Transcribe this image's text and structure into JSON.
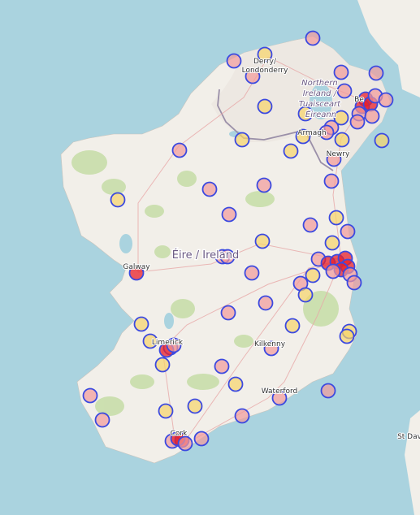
{
  "map": {
    "country_label": "Éire / Ireland",
    "region_label_lines": [
      "Northern",
      "Ireland /",
      "Tuaisceart",
      "Éireann"
    ],
    "places": [
      {
        "id": "derry",
        "lines": [
          "Derry/",
          "Londonderry"
        ]
      },
      {
        "id": "armagh",
        "lines": [
          "Armagh"
        ]
      },
      {
        "id": "newry",
        "lines": [
          "Newry"
        ]
      },
      {
        "id": "belfast",
        "lines": [
          "Be"
        ]
      },
      {
        "id": "galway",
        "lines": [
          "Galway"
        ]
      },
      {
        "id": "limerick",
        "lines": [
          "Limerick"
        ]
      },
      {
        "id": "kilkenny",
        "lines": [
          "Kilkenny"
        ]
      },
      {
        "id": "waterford",
        "lines": [
          "Waterford"
        ]
      },
      {
        "id": "cork",
        "lines": [
          "Cork"
        ]
      },
      {
        "id": "stdavids",
        "lines": [
          "St Dav"
        ]
      }
    ],
    "marker_styles": {
      "border": "#3b49e0",
      "fill_low": "#f6d46a",
      "fill_mid": "#f29a9a",
      "fill_high": "#e8202a"
    }
  }
}
